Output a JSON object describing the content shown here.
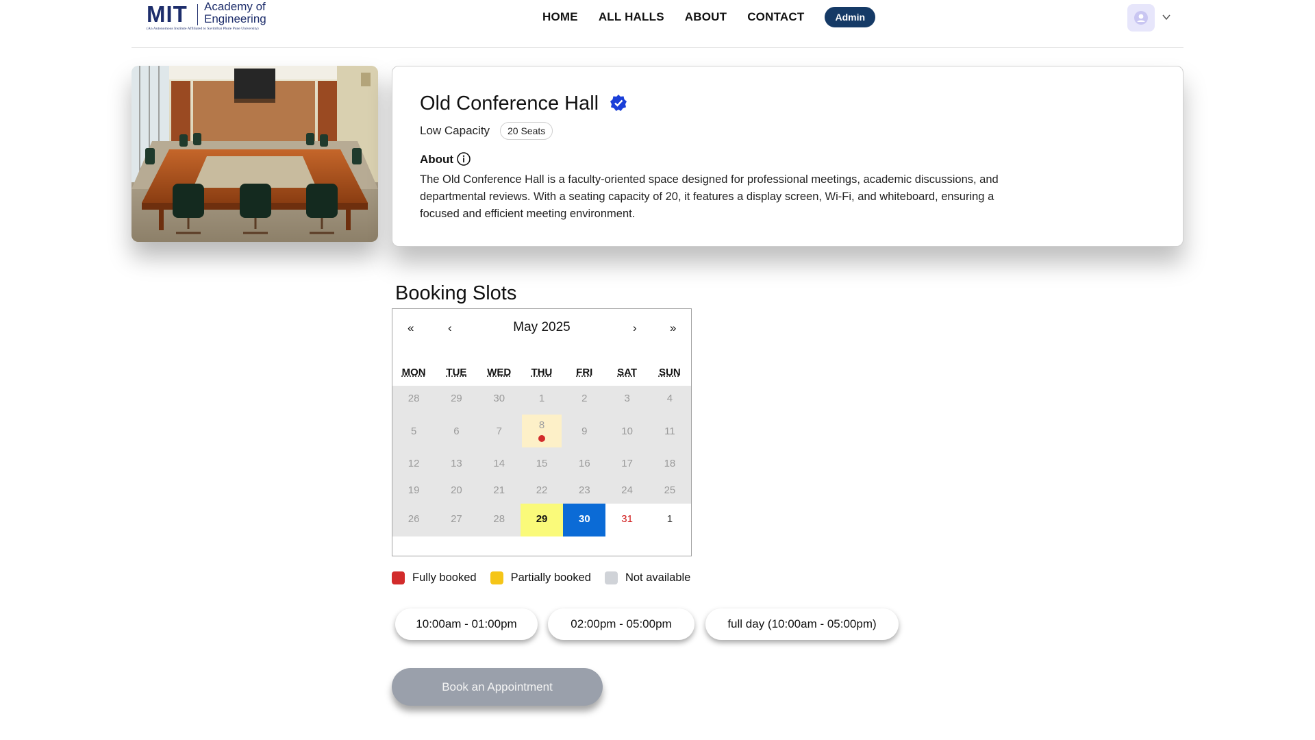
{
  "header": {
    "logo_mark": "MIT",
    "logo_name": "Academy of Engineering",
    "logo_subtitle": "(An Autonomous Institute Affiliated to Savitribai Phule Pune University)",
    "nav": [
      {
        "label": "HOME"
      },
      {
        "label": "ALL HALLS"
      },
      {
        "label": "ABOUT"
      },
      {
        "label": "CONTACT"
      }
    ],
    "admin_label": "Admin",
    "avatar_icon": "user-icon",
    "menu_icon": "chevron-down-icon"
  },
  "hall": {
    "title": "Old Conference Hall",
    "verified_icon": "verified-badge-icon",
    "capacity_label": "Low Capacity",
    "seats": "20 Seats",
    "about_label": "About",
    "about_icon": "info-icon",
    "description": "The Old Conference Hall is a faculty-oriented space designed for professional meetings, academic discussions, and departmental reviews. With a seating capacity of 20, it features a display screen, Wi-Fi, and whiteboard, ensuring a focused and efficient meeting environment."
  },
  "booking": {
    "title": "Booking Slots",
    "calendar": {
      "month": "May 2025",
      "nav": {
        "prev_year": "«",
        "prev_month": "‹",
        "next_month": "›",
        "next_year": "»"
      },
      "weekdays": [
        "MON",
        "TUE",
        "WED",
        "THU",
        "FRI",
        "SAT",
        "SUN"
      ],
      "weeks": [
        [
          "28",
          "29",
          "30",
          "1",
          "2",
          "3",
          "4"
        ],
        [
          "5",
          "6",
          "7",
          "8",
          "9",
          "10",
          "11"
        ],
        [
          "12",
          "13",
          "14",
          "15",
          "16",
          "17",
          "18"
        ],
        [
          "19",
          "20",
          "21",
          "22",
          "23",
          "24",
          "25"
        ],
        [
          "26",
          "27",
          "28",
          "29",
          "30",
          "31",
          "1"
        ]
      ],
      "marked": {
        "partially_booked_with_dot": "8",
        "highlighted": "29",
        "selected": "30",
        "weekend_highlight": "31"
      }
    },
    "legend": [
      {
        "label": "Fully booked",
        "color": "#d22b2b"
      },
      {
        "label": "Partially booked",
        "color": "#f5c518"
      },
      {
        "label": "Not available",
        "color": "#d0d3d8"
      }
    ],
    "slots": [
      {
        "label": "10:00am - 01:00pm"
      },
      {
        "label": "02:00pm - 05:00pm"
      },
      {
        "label": "full day (10:00am - 05:00pm)"
      }
    ],
    "book_button": "Book an Appointment"
  }
}
